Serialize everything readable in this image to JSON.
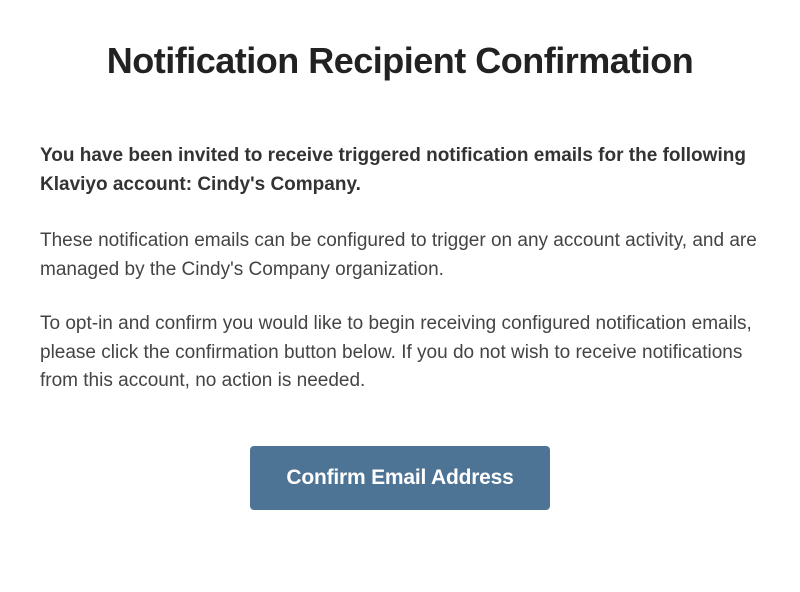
{
  "title": "Notification Recipient Confirmation",
  "intro": "You have been invited to receive triggered notification emails for the following Klaviyo account: Cindy's Company.",
  "para1": "These notification emails can be configured to trigger on any account activity, and are managed by the Cindy's Company organization.",
  "para2": "To opt-in and confirm you would like to begin receiving configured notification emails, please click the confirmation button below. If you do not wish to receive notifications from this account, no action is needed.",
  "button_label": "Confirm Email Address"
}
